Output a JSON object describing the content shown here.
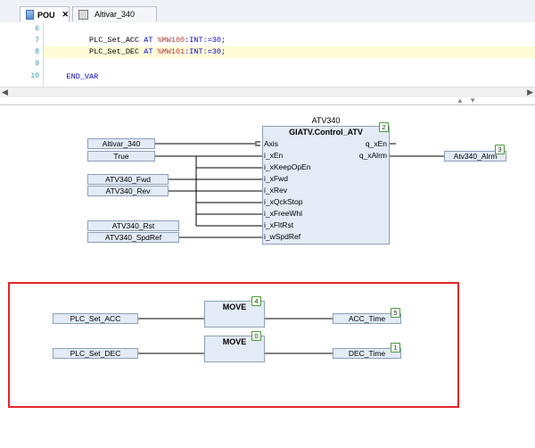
{
  "tabs": [
    {
      "label": "POU",
      "close": "✕",
      "icon": "pou-icon",
      "active": true
    },
    {
      "label": "Altivar_340",
      "icon": "device-icon",
      "active": false
    }
  ],
  "editor": {
    "lines": [
      {
        "num": "6",
        "text": ""
      },
      {
        "num": "7",
        "name": "PLC_Set_ACC",
        "at": "AT",
        "addr": "%MW100",
        "type": ":INT:=30;"
      },
      {
        "num": "8",
        "name": "PLC_Set_DEC",
        "at": "AT",
        "addr": "%MW101",
        "type": ":INT:=30;"
      },
      {
        "num": "9",
        "text": ""
      },
      {
        "num": "10",
        "endvar": "END_VAR"
      }
    ]
  },
  "scrollbar": {
    "left_arrow": "◀",
    "right_arrow": "▶",
    "splitter_arrows": "▲ ▼"
  },
  "fbd": {
    "fb_instance": "ATV340",
    "fb_type": "GIATV.Control_ATV",
    "fb_badge": "2",
    "fb_inputs": [
      "Axis",
      "i_xEn",
      "i_xKeepOpEn",
      "i_xFwd",
      "i_xRev",
      "i_xQckStop",
      "i_xFreeWhl",
      "i_xFltRst",
      "i_wSpdRef"
    ],
    "fb_outputs": [
      "q_xEn",
      "q_xAlrm"
    ],
    "input_vars": [
      "Altivar_340",
      "True",
      "ATV340_Fwd",
      "ATV340_Rev",
      "ATV340_Rst",
      "ATV340_SpdRef"
    ],
    "output_var": "Atv340_Alrm",
    "output_badge": "3",
    "move1": {
      "title": "MOVE",
      "badge": "4",
      "in": "PLC_Set_ACC",
      "out": "ACC_Time",
      "out_badge": "5"
    },
    "move2": {
      "title": "MOVE",
      "badge": "0",
      "in": "PLC_Set_DEC",
      "out": "DEC_Time",
      "out_badge": "1"
    }
  }
}
